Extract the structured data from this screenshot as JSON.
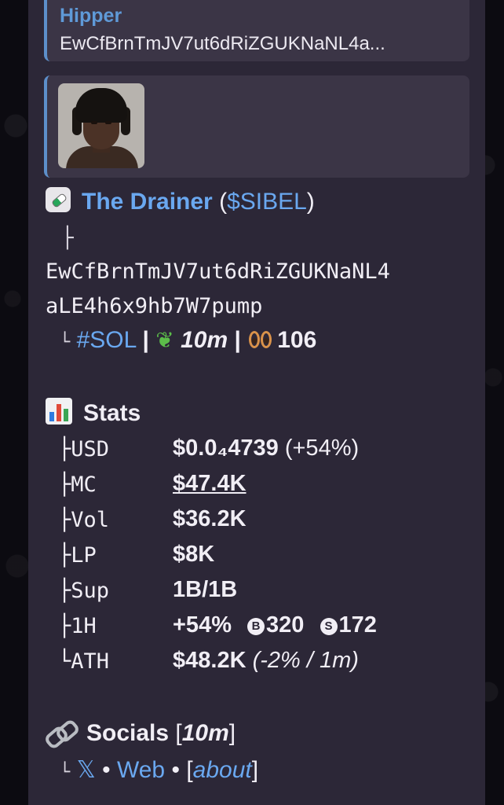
{
  "reply": {
    "name": "Hipper",
    "text": "EwCfBrnTmJV7ut6dRiZGUKNaNL4a..."
  },
  "token": {
    "name": "The Drainer",
    "open_paren": "(",
    "ticker": "$SIBEL",
    "close_paren": ")",
    "branch_glyph": "├",
    "address_line1": "EwCfBrnTmJV7ut6dRiZGUKNaNL4",
    "address_line2": "aLE4h6x9hb7W7pump",
    "end_glyph": "└",
    "chain": "#SOL",
    "separator": "|",
    "age": "10m",
    "eyes_count": "106"
  },
  "stats": {
    "title": "Stats",
    "rows": [
      {
        "glyph": "├",
        "key": "USD",
        "value": "$0.0₄4739",
        "extra": "(+54%)"
      },
      {
        "glyph": "├",
        "key": "MC",
        "value": "$47.4K"
      },
      {
        "glyph": "├",
        "key": "Vol",
        "value": "$36.2K"
      },
      {
        "glyph": "├",
        "key": "LP",
        "value": "$8K"
      },
      {
        "glyph": "├",
        "key": "Sup",
        "value": "1B/1B"
      },
      {
        "glyph": "├",
        "key": "1H",
        "value": "+54%",
        "buys_icon": "B",
        "buys": "320",
        "sells_icon": "S",
        "sells": "172"
      },
      {
        "glyph": "└",
        "key": "ATH",
        "value": "$48.2K",
        "extra": "(-2% / 1m)"
      }
    ]
  },
  "socials": {
    "title": "Socials",
    "open_bracket": "[",
    "age": "10m",
    "close_bracket": "]",
    "end_glyph": "└",
    "x_label": "𝕏",
    "dot": "•",
    "web_label": "Web",
    "about_open": "[",
    "about_label": "about",
    "about_close": "]"
  },
  "icons": {
    "token_icon": "pill-icon",
    "age_icon": "sprout-icon",
    "watchers_icon": "eyes-icon",
    "stats_icon": "bar-chart-icon",
    "socials_icon": "link-icon"
  },
  "colors": {
    "accent_link": "#6aa8f0",
    "quote_bar": "#5d8fca",
    "reply_name": "#5f9ad8"
  }
}
